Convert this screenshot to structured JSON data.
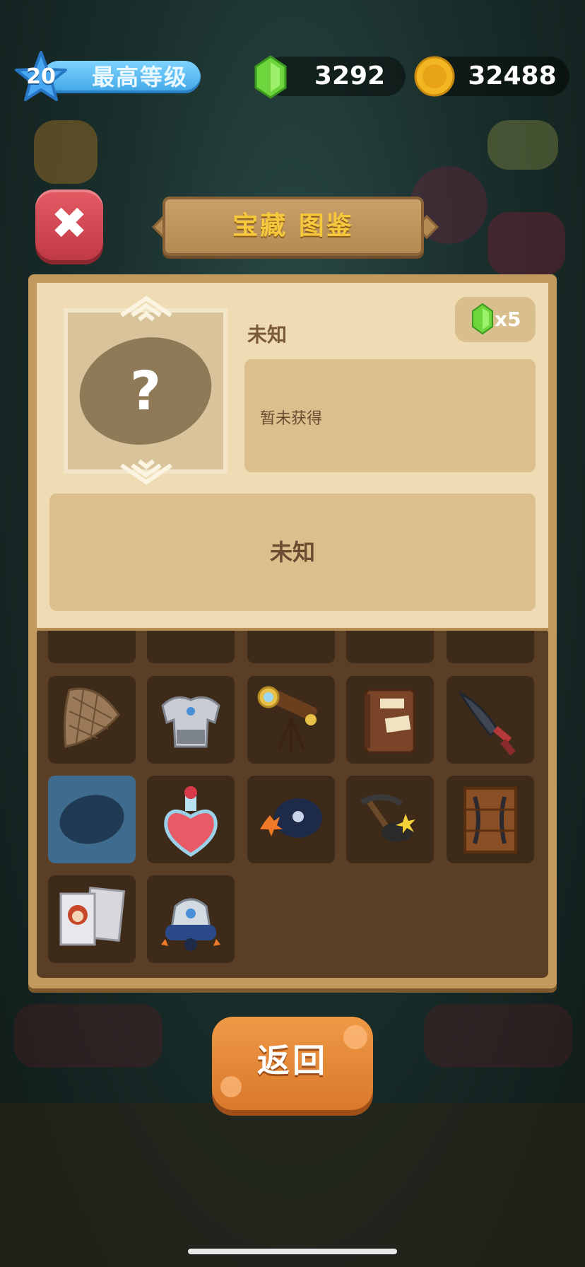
{
  "top_bar": {
    "level_number": "20",
    "level_label": "最高等级",
    "gems": "3292",
    "coins": "32488"
  },
  "panel": {
    "title": "宝藏 图鉴"
  },
  "item_card": {
    "name": "未知",
    "price": "x5",
    "description": "暂未获得",
    "lower_text": "未知",
    "placeholder_symbol": "?"
  },
  "grid": {
    "items": [
      {
        "name": "net-icon"
      },
      {
        "name": "armor-icon"
      },
      {
        "name": "telescope-icon"
      },
      {
        "name": "book-icon"
      },
      {
        "name": "sword-icon"
      },
      {
        "name": "unknown-slot",
        "selected": true
      },
      {
        "name": "potion-icon"
      },
      {
        "name": "bomb-icon"
      },
      {
        "name": "pickaxe-icon"
      },
      {
        "name": "crate-icon"
      },
      {
        "name": "cards-icon"
      },
      {
        "name": "robot-icon"
      }
    ]
  },
  "back_button": {
    "label": "返回"
  },
  "colors": {
    "gold": "#f6c83c",
    "board": "#c39a5d",
    "card": "#efdcb4",
    "close": "#d24a54",
    "back": "#e6873a"
  }
}
